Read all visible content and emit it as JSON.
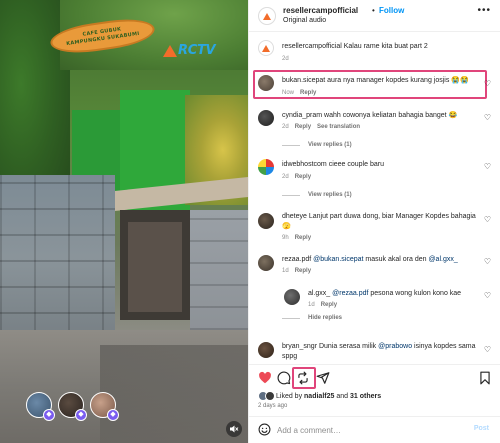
{
  "video": {
    "sign_lines": [
      "CAFE GUBUK",
      "KAMPUNGKU SUKABUMI"
    ],
    "logo_text": "RCTV",
    "icons": {
      "mute": "mute-icon",
      "collab_badge": "collab-badge-icon"
    }
  },
  "header": {
    "username": "resellercampofficial",
    "dot": "•",
    "follow_label": "Follow",
    "audio": "Original audio",
    "more_icon": "more-icon"
  },
  "caption": {
    "username": "resellercampofficial",
    "text": "Kalau rame kita buat part 2",
    "time": "2d"
  },
  "comments": [
    {
      "username": "bukan.sicepat",
      "text": "aura nya manager kopdes kurang josjis 😭😭",
      "time": "Now",
      "reply": "Reply"
    },
    {
      "username": "cyndia_pram",
      "text": "wahh cowonya keliatan bahagia banget 😂",
      "time": "2d",
      "reply": "Reply",
      "see_translation": "See translation",
      "view_replies": "View replies (1)"
    },
    {
      "username": "idwebhostcom",
      "text": "cieee couple baru",
      "time": "2d",
      "reply": "Reply",
      "view_replies": "View replies (1)"
    },
    {
      "username": "dheteye",
      "text": "Lanjut part duwa dong, biar Manager Kopdes bahagia 🫣",
      "time": "9h",
      "reply": "Reply"
    },
    {
      "username": "rezaa.pdf",
      "mention": "@bukan.sicepat",
      "text": "masuk akal ora den",
      "mention2": "@al.gxx_",
      "time": "1d",
      "reply": "Reply"
    },
    {
      "username": "al.gxx_",
      "mention": "@rezaa.pdf",
      "text": "pesona wong kulon kono kae",
      "time": "1d",
      "reply": "Reply",
      "hide_replies": "Hide replies"
    },
    {
      "username": "bryan_sngr",
      "text": "Dunia serasa milik",
      "mention": "@prabowo",
      "text2": "isinya kopdes sama sppg"
    }
  ],
  "actions": {
    "liked_prefix": "Liked by",
    "liked_user": "nadialf25",
    "liked_and": "and",
    "liked_others": "31 others",
    "time_ago": "2 days ago"
  },
  "add_comment": {
    "placeholder": "Add a comment…",
    "post_label": "Post"
  },
  "colors": {
    "accent_blue": "#0095f6",
    "highlight": "#e0457b",
    "like_red": "#ed4956",
    "mention": "#00376b"
  }
}
